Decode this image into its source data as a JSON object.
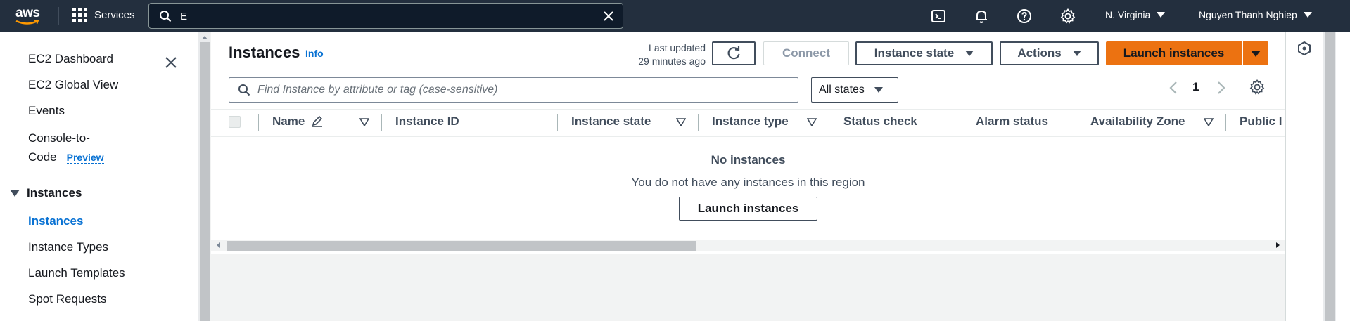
{
  "topnav": {
    "logo_text": "aws",
    "services_label": "Services",
    "search_value": "E",
    "region_label": "N. Virginia",
    "user_label": "Nguyen Thanh Nghiep",
    "icons": [
      "cloudshell-icon",
      "notifications-icon",
      "help-icon",
      "settings-icon"
    ]
  },
  "sidebar": {
    "items": [
      {
        "label": "EC2 Dashboard"
      },
      {
        "label": "EC2 Global View"
      },
      {
        "label": "Events"
      },
      {
        "label": "Console-to-"
      },
      {
        "label": "Code"
      }
    ],
    "preview_badge": "Preview",
    "section_label": "Instances",
    "section_items": [
      {
        "label": "Instances",
        "active": true
      },
      {
        "label": "Instance Types"
      },
      {
        "label": "Launch Templates"
      },
      {
        "label": "Spot Requests"
      }
    ]
  },
  "main": {
    "title": "Instances",
    "info_label": "Info",
    "last_updated_line1": "Last updated",
    "last_updated_line2": "29 minutes ago",
    "connect_label": "Connect",
    "instance_state_label": "Instance state",
    "actions_label": "Actions",
    "launch_label": "Launch instances",
    "filter_placeholder": "Find Instance by attribute or tag (case-sensitive)",
    "states_label": "All states",
    "page_number": "1",
    "columns": [
      "Name",
      "Instance ID",
      "Instance state",
      "Instance type",
      "Status check",
      "Alarm status",
      "Availability Zone",
      "Public I"
    ],
    "empty_title": "No instances",
    "empty_message": "You do not have any instances in this region",
    "empty_button": "Launch instances"
  },
  "colors": {
    "nav_bg": "#232f3e",
    "primary": "#ec7211",
    "link": "#0972d3"
  }
}
